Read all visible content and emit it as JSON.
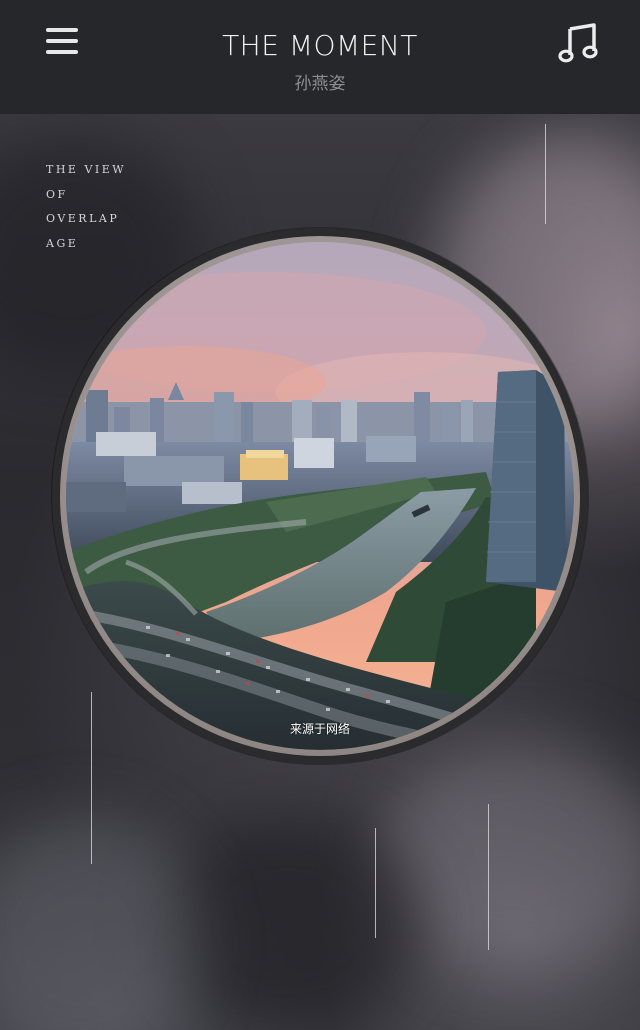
{
  "header": {
    "title": "THE MOMENT",
    "subtitle": "孙燕姿",
    "menu_icon": "hamburger-menu-icon",
    "music_icon": "music-note-icon"
  },
  "side_text": {
    "lines": [
      "THE VIEW",
      "OF",
      "OVERLAP",
      "AGE"
    ]
  },
  "photo": {
    "caption": "来源于网络"
  },
  "colors": {
    "header_bg": "#25272a",
    "title": "#f2f2f2",
    "subtitle": "#8d8f93",
    "sky_top": "#b7a6b8",
    "sky_glow": "#f0a58c"
  }
}
